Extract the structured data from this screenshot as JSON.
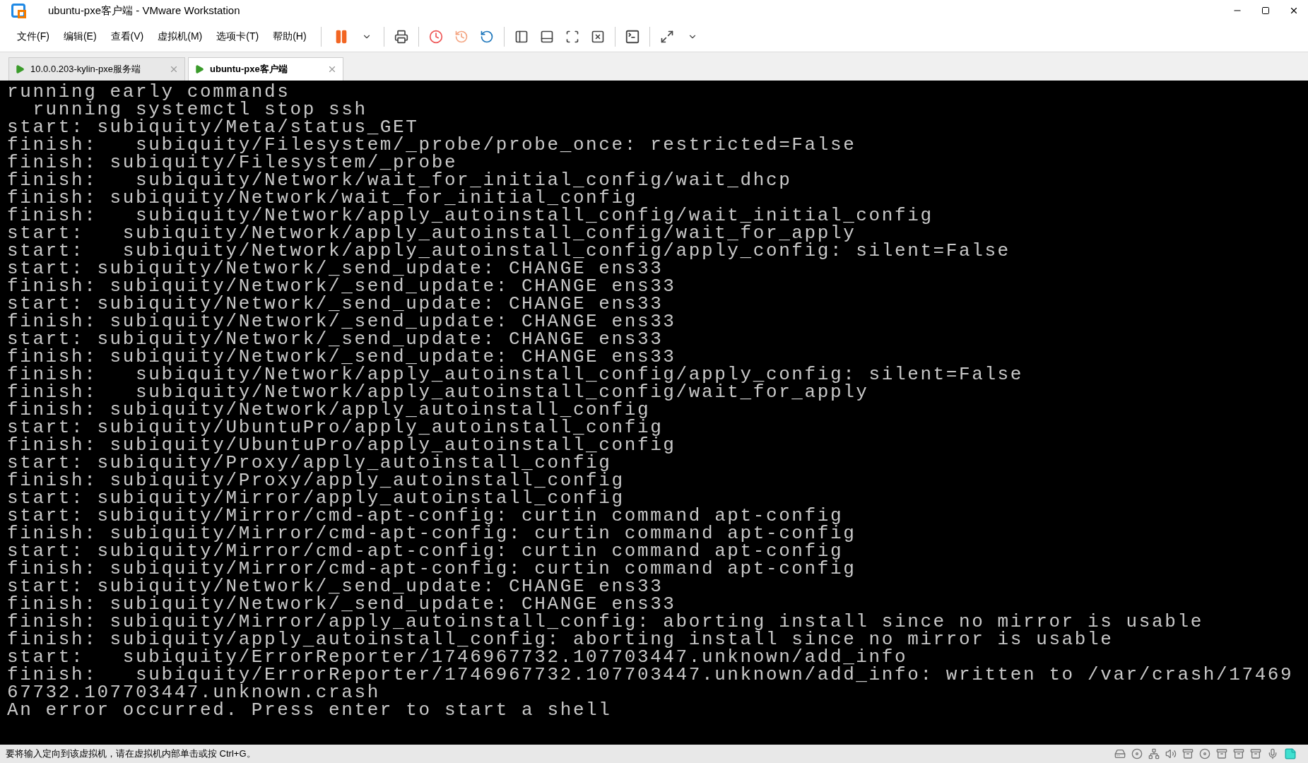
{
  "window": {
    "title": "ubuntu-pxe客户端 - VMware Workstation"
  },
  "menu": [
    "文件(F)",
    "编辑(E)",
    "查看(V)",
    "虚拟机(M)",
    "选项卡(T)",
    "帮助(H)"
  ],
  "tabs": [
    {
      "label": "10.0.0.203-kylin-pxe服务端",
      "selected": false
    },
    {
      "label": "ubuntu-pxe客户端",
      "selected": true
    }
  ],
  "terminal": {
    "lines": [
      "running early commands",
      "  running systemctl stop ssh",
      "start: subiquity/Meta/status_GET",
      "finish:   subiquity/Filesystem/_probe/probe_once: restricted=False",
      "finish: subiquity/Filesystem/_probe",
      "finish:   subiquity/Network/wait_for_initial_config/wait_dhcp",
      "finish: subiquity/Network/wait_for_initial_config",
      "finish:   subiquity/Network/apply_autoinstall_config/wait_initial_config",
      "start:   subiquity/Network/apply_autoinstall_config/wait_for_apply",
      "start:   subiquity/Network/apply_autoinstall_config/apply_config: silent=False",
      "start: subiquity/Network/_send_update: CHANGE ens33",
      "finish: subiquity/Network/_send_update: CHANGE ens33",
      "start: subiquity/Network/_send_update: CHANGE ens33",
      "finish: subiquity/Network/_send_update: CHANGE ens33",
      "start: subiquity/Network/_send_update: CHANGE ens33",
      "finish: subiquity/Network/_send_update: CHANGE ens33",
      "finish:   subiquity/Network/apply_autoinstall_config/apply_config: silent=False",
      "finish:   subiquity/Network/apply_autoinstall_config/wait_for_apply",
      "finish: subiquity/Network/apply_autoinstall_config",
      "start: subiquity/UbuntuPro/apply_autoinstall_config",
      "finish: subiquity/UbuntuPro/apply_autoinstall_config",
      "start: subiquity/Proxy/apply_autoinstall_config",
      "finish: subiquity/Proxy/apply_autoinstall_config",
      "start: subiquity/Mirror/apply_autoinstall_config",
      "start: subiquity/Mirror/cmd-apt-config: curtin command apt-config",
      "finish: subiquity/Mirror/cmd-apt-config: curtin command apt-config",
      "start: subiquity/Mirror/cmd-apt-config: curtin command apt-config",
      "finish: subiquity/Mirror/cmd-apt-config: curtin command apt-config",
      "start: subiquity/Network/_send_update: CHANGE ens33",
      "finish: subiquity/Network/_send_update: CHANGE ens33",
      "finish: subiquity/Mirror/apply_autoinstall_config: aborting install since no mirror is usable",
      "finish: subiquity/apply_autoinstall_config: aborting install since no mirror is usable",
      "start:   subiquity/ErrorReporter/1746967732.107703447.unknown/add_info",
      "finish:   subiquity/ErrorReporter/1746967732.107703447.unknown/add_info: written to /var/crash/17469",
      "67732.107703447.unknown.crash",
      "An error occurred. Press enter to start a shell"
    ]
  },
  "status_bar": {
    "text": "要将输入定向到该虚拟机，请在虚拟机内部单击或按 Ctrl+G。"
  }
}
